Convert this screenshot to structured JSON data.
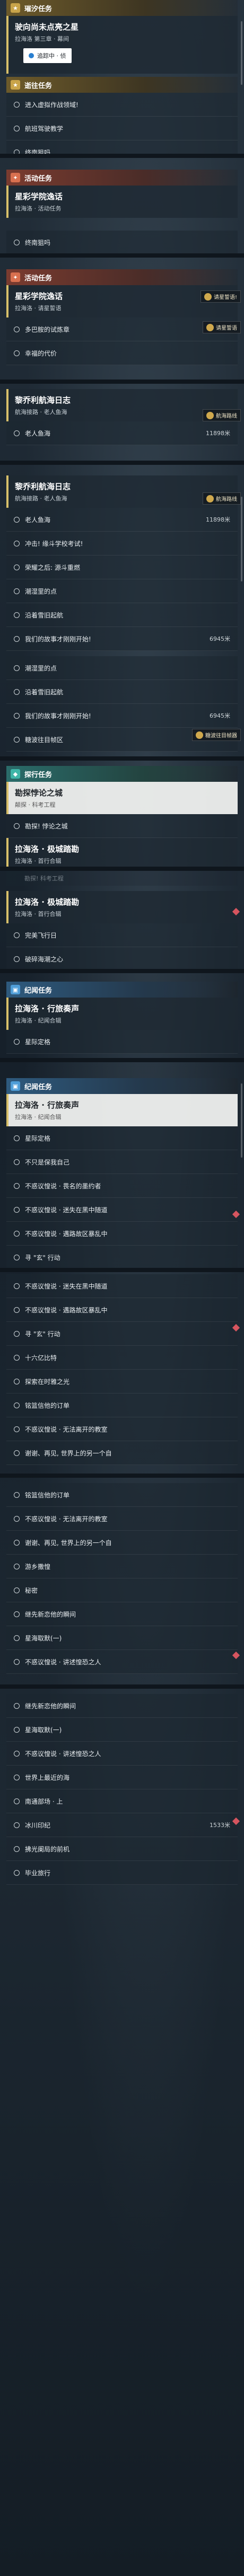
{
  "s1": {
    "header": "璀汐任务",
    "card_title": "驶向尚未点亮之星",
    "card_sub": "拉海洛 第三章 · 幕间",
    "track_btn": "追踪中 · 侦",
    "legend_header": "逝往任务",
    "tasks": [
      "进入虚拟作战领域!",
      "航班驾驶教学",
      "终南狙吗"
    ]
  },
  "s2": {
    "header": "活动任务",
    "card_title": "星彩学院逸话",
    "card_sub": "拉海洛 · 活动任务",
    "tasks": [
      "终南狙吗"
    ]
  },
  "s3": {
    "header": "活动任务",
    "card_title": "星彩学院逸话",
    "card_sub": "拉海洛 · 请星誓语",
    "tasks": [
      "多巴胺的试炼章",
      "幸福的代价"
    ],
    "tips": [
      "请星誓语!",
      "请星誓语"
    ]
  },
  "s4": {
    "card_title": "黎乔利航海日志",
    "card_sub": "航海接路 · 老人鱼海",
    "tasks": [
      "老人鱼海"
    ],
    "dist": "11898米",
    "tip": "航海路线"
  },
  "s5": {
    "card_title": "黎乔利航海日志",
    "card_sub": "航海接路 · 老人鱼海",
    "tip": "航海路线",
    "tasks": [
      "老人鱼海",
      "冲击! 缘斗学校考试!",
      "荣耀之后: 源斗重燃",
      "潮湿里的点",
      "沿着雪旧起航",
      "我们的故事才刚刚开始!",
      "潮湿里的点",
      "沿着雪旧起航",
      "我们的故事才刚刚开始!",
      "糖波往目帧区"
    ],
    "dists": [
      "11898米",
      "6945米",
      "6945米"
    ],
    "tip2": "糖波往目帧器"
  },
  "s6": {
    "header": "探行任务",
    "card_title": "勘探悖论之城",
    "card_sub": "颠探 · 科考工程",
    "tasks": [
      "勘探! 悖论之城",
      "拉海洛 · 极城踏勘"
    ],
    "card2_title": "拉海洛 · 极城踏勘",
    "card2_sub": "拉海洛 · 首行合辑"
  },
  "s7": {
    "faded": "勘探! 科考工程",
    "card_title": "拉海洛 · 极城踏勘",
    "card_sub": "拉海洛 · 首行合辑",
    "tasks": [
      "完美飞行日",
      "破碎海潮之心"
    ]
  },
  "s8": {
    "header": "纪闻任务",
    "card_title": "拉海洛 · 行旅奏声",
    "card_sub": "拉海洛 · 纪闻合辑",
    "tasks": [
      "星际定格"
    ]
  },
  "s9": {
    "header": "纪闻任务",
    "card_title": "拉海洛 · 行旅奏声",
    "card_sub": "拉海洛 · 纪闻合辑",
    "tasks": [
      "星际定格",
      "不只是保我自己",
      "不惑议惶说 · 畏名的墨约者",
      "不惑议惶说 · 迷失在黑中随道",
      "不惑议惶说 · 遇路故区暴乱中",
      "寻 \"玄\" 行动"
    ]
  },
  "s10": {
    "tasks": [
      "不惑议惶说 · 迷失在黑中随道",
      "不惑议惶说 · 遇路故区暴乱中",
      "寻 \"玄\" 行动",
      "十六亿比特",
      "探索在时雅之光",
      "铭篮信他的订单",
      "不惑议惶说 · 无法离开的教室",
      "谢谢、再见, 世界上的另一个自"
    ]
  },
  "s11": {
    "tasks": [
      "铭篮信他的订单",
      "不惑议惶说 · 无法离开的教室",
      "谢谢、再见, 世界上的另一个自",
      "游乡撒惶",
      "秘密",
      "继先新恋他的瞬间",
      "星海取默(一)",
      "不惑议惶说 · 讲述惶恐之人"
    ]
  },
  "s12": {
    "tasks": [
      "继先新恋他的瞬间",
      "星海取默(一)",
      "不惑议惶说 · 讲述惶恐之人",
      "世界上最近的海",
      "南通部场 · 上",
      "冰川印纪",
      "拂光阑局的前机",
      "毕业旅行"
    ],
    "dist": "1533米"
  }
}
